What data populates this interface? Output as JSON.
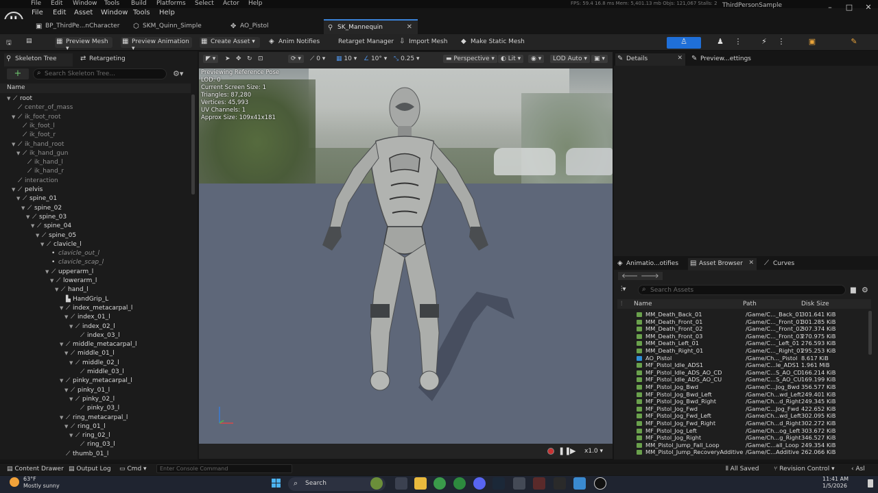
{
  "top_menu": [
    "File",
    "Edit",
    "Window",
    "Tools",
    "Build",
    "Platforms",
    "Select",
    "Actor",
    "Help"
  ],
  "top_stats": "FPS: 59.4   16.8 ms   Mem: 5,401.13 mb   Objs: 121,067   Stalls: 2",
  "menu": [
    "File",
    "Edit",
    "Asset",
    "Window",
    "Tools",
    "Help"
  ],
  "project_title": "ThirdPersonSample",
  "logo_letter": "U",
  "window_buttons": [
    "–",
    "□",
    "✕"
  ],
  "asset_tabs": [
    {
      "label": "BP_ThirdPe...nCharacter",
      "icon": "blueprint-icon"
    },
    {
      "label": "SKM_Quinn_Simple",
      "icon": "mesh-icon"
    },
    {
      "label": "AO_Pistol",
      "icon": "aimoffset-icon"
    },
    {
      "label": "SK_Mannequin",
      "icon": "skeleton-icon",
      "active": true
    }
  ],
  "toolbar": {
    "preview_mesh": "Preview Mesh",
    "preview_animation": "Preview Animation",
    "create_asset": "Create Asset",
    "anim_notifies": "Anim Notifies",
    "retarget_manager": "Retarget Manager",
    "import_mesh": "Import Mesh",
    "make_static_mesh": "Make Static Mesh"
  },
  "accent_color": "#1f6fd8",
  "left_panel": {
    "tabs": [
      "Skeleton Tree",
      "Retargeting"
    ],
    "search_placeholder": "Search Skeleton Tree...",
    "column_name": "Name",
    "bones": [
      {
        "name": "root",
        "depth": 0,
        "style": "normal"
      },
      {
        "name": "center_of_mass",
        "depth": 1,
        "style": "muted"
      },
      {
        "name": "ik_foot_root",
        "depth": 1,
        "style": "muted"
      },
      {
        "name": "ik_foot_l",
        "depth": 2,
        "style": "muted"
      },
      {
        "name": "ik_foot_r",
        "depth": 2,
        "style": "muted"
      },
      {
        "name": "ik_hand_root",
        "depth": 1,
        "style": "muted"
      },
      {
        "name": "ik_hand_gun",
        "depth": 2,
        "style": "muted"
      },
      {
        "name": "ik_hand_l",
        "depth": 3,
        "style": "muted"
      },
      {
        "name": "ik_hand_r",
        "depth": 3,
        "style": "muted"
      },
      {
        "name": "interaction",
        "depth": 1,
        "style": "muted"
      },
      {
        "name": "pelvis",
        "depth": 1,
        "style": "normal"
      },
      {
        "name": "spine_01",
        "depth": 2,
        "style": "normal"
      },
      {
        "name": "spine_02",
        "depth": 3,
        "style": "normal"
      },
      {
        "name": "spine_03",
        "depth": 4,
        "style": "normal"
      },
      {
        "name": "spine_04",
        "depth": 5,
        "style": "normal"
      },
      {
        "name": "spine_05",
        "depth": 6,
        "style": "normal"
      },
      {
        "name": "clavicle_l",
        "depth": 7,
        "style": "normal"
      },
      {
        "name": "clavicle_out_l",
        "depth": 8,
        "style": "italic"
      },
      {
        "name": "clavicle_scap_l",
        "depth": 8,
        "style": "italic"
      },
      {
        "name": "upperarm_l",
        "depth": 8,
        "style": "normal"
      },
      {
        "name": "lowerarm_l",
        "depth": 9,
        "style": "normal"
      },
      {
        "name": "hand_l",
        "depth": 10,
        "style": "normal"
      },
      {
        "name": "HandGrip_L",
        "depth": 11,
        "style": "socket"
      },
      {
        "name": "index_metacarpal_l",
        "depth": 11,
        "style": "normal"
      },
      {
        "name": "index_01_l",
        "depth": 12,
        "style": "normal"
      },
      {
        "name": "index_02_l",
        "depth": 13,
        "style": "normal"
      },
      {
        "name": "index_03_l",
        "depth": 14,
        "style": "normal"
      },
      {
        "name": "middle_metacarpal_l",
        "depth": 11,
        "style": "normal"
      },
      {
        "name": "middle_01_l",
        "depth": 12,
        "style": "normal"
      },
      {
        "name": "middle_02_l",
        "depth": 13,
        "style": "normal"
      },
      {
        "name": "middle_03_l",
        "depth": 14,
        "style": "normal"
      },
      {
        "name": "pinky_metacarpal_l",
        "depth": 11,
        "style": "normal"
      },
      {
        "name": "pinky_01_l",
        "depth": 12,
        "style": "normal"
      },
      {
        "name": "pinky_02_l",
        "depth": 13,
        "style": "normal"
      },
      {
        "name": "pinky_03_l",
        "depth": 14,
        "style": "normal"
      },
      {
        "name": "ring_metacarpal_l",
        "depth": 11,
        "style": "normal"
      },
      {
        "name": "ring_01_l",
        "depth": 12,
        "style": "normal"
      },
      {
        "name": "ring_02_l",
        "depth": 13,
        "style": "normal"
      },
      {
        "name": "ring_03_l",
        "depth": 14,
        "style": "normal"
      },
      {
        "name": "thumb_01_l",
        "depth": 11,
        "style": "normal"
      }
    ]
  },
  "viewport": {
    "snap_angle": "0",
    "grid_size": "10",
    "rotation_snap": "10°",
    "scale_snap": "0.25",
    "view_mode": "Perspective",
    "lighting": "Lit",
    "lod": "LOD Auto",
    "info": [
      "Previewing Reference Pose",
      "LOD: 0",
      "Current Screen Size: 1",
      "Triangles: 87,280",
      "Vertices: 45,993",
      "UV Channels: 1",
      "Approx Size: 109x41x181"
    ],
    "playback_speed": "x1.0"
  },
  "details": {
    "tabs": [
      "Details",
      "Preview...ettings"
    ]
  },
  "asset_browser": {
    "tabs": [
      "Animatio...otifies",
      "Asset Browser",
      "Curves"
    ],
    "search_placeholder": "Search Assets",
    "columns": [
      "Name",
      "Path",
      "Disk Size"
    ],
    "rows": [
      {
        "name": "MM_Death_Back_01",
        "path": "/Game/C..._Back_01",
        "size": "301.641 KiB",
        "type": "anim"
      },
      {
        "name": "MM_Death_Front_01",
        "path": "/Game/C..._Front_01",
        "size": "301.285 KiB",
        "type": "anim"
      },
      {
        "name": "MM_Death_Front_02",
        "path": "/Game/C..._Front_02",
        "size": "307.374 KiB",
        "type": "anim"
      },
      {
        "name": "MM_Death_Front_03",
        "path": "/Game/C..._Front_03",
        "size": "270.975 KiB",
        "type": "anim"
      },
      {
        "name": "MM_Death_Left_01",
        "path": "/Game/C..._Left_01",
        "size": "276.593 KiB",
        "type": "anim"
      },
      {
        "name": "MM_Death_Right_01",
        "path": "/Game/C..._Right_01",
        "size": "295.253 KiB",
        "type": "anim"
      },
      {
        "name": "AO_Pistol",
        "path": "/Game/Ch..._Pistol",
        "size": "8.617 KiB",
        "type": "aimoffset"
      },
      {
        "name": "MF_Pistol_Idle_ADS1",
        "path": "/Game/C...le_ADS1",
        "size": "1.961 MiB",
        "type": "anim"
      },
      {
        "name": "MF_Pistol_Idle_ADS_AO_CD",
        "path": "/Game/C...S_AO_CD",
        "size": "166.214 KiB",
        "type": "anim"
      },
      {
        "name": "MF_Pistol_Idle_ADS_AO_CU",
        "path": "/Game/C...S_AO_CU",
        "size": "169.199 KiB",
        "type": "anim"
      },
      {
        "name": "MF_Pistol_Jog_Bwd",
        "path": "/Game/C...Jog_Bwd",
        "size": "356.577 KiB",
        "type": "anim"
      },
      {
        "name": "MF_Pistol_Jog_Bwd_Left",
        "path": "/Game/Ch...wd_Left",
        "size": "249.401 KiB",
        "type": "anim"
      },
      {
        "name": "MF_Pistol_Jog_Bwd_Right",
        "path": "/Game/Ch...d_Right",
        "size": "249.345 KiB",
        "type": "anim"
      },
      {
        "name": "MF_Pistol_Jog_Fwd",
        "path": "/Game/C...Jog_Fwd",
        "size": "422.652 KiB",
        "type": "anim"
      },
      {
        "name": "MF_Pistol_Jog_Fwd_Left",
        "path": "/Game/Ch...wd_Left",
        "size": "302.095 KiB",
        "type": "anim"
      },
      {
        "name": "MF_Pistol_Jog_Fwd_Right",
        "path": "/Game/Ch...d_Right",
        "size": "302.272 KiB",
        "type": "anim"
      },
      {
        "name": "MF_Pistol_Jog_Left",
        "path": "/Game/Ch...og_Left",
        "size": "303.672 KiB",
        "type": "anim"
      },
      {
        "name": "MF_Pistol_Jog_Right",
        "path": "/Game/Ch...g_Right",
        "size": "346.527 KiB",
        "type": "anim"
      },
      {
        "name": "MM_Pistol_Jump_Fall_Loop",
        "path": "/Game/C...all_Loop",
        "size": "249.354 KiB",
        "type": "anim"
      },
      {
        "name": "MM_Pistol_Jump_RecoveryAdditive",
        "path": "/Game/C...Additive",
        "size": "262.066 KiB",
        "type": "anim"
      }
    ]
  },
  "status_bar": {
    "content_drawer": "Content Drawer",
    "output_log": "Output Log",
    "cmd": "Cmd",
    "console_placeholder": "Enter Console Command",
    "all_saved": "All Saved",
    "revision_control": "Revision Control",
    "right_cut": "Asl"
  },
  "taskbar": {
    "weather_temp": "63°F",
    "weather_desc": "Mostly sunny",
    "search_label": "Search",
    "time": "11:41 AM",
    "date": "1/5/2026"
  }
}
